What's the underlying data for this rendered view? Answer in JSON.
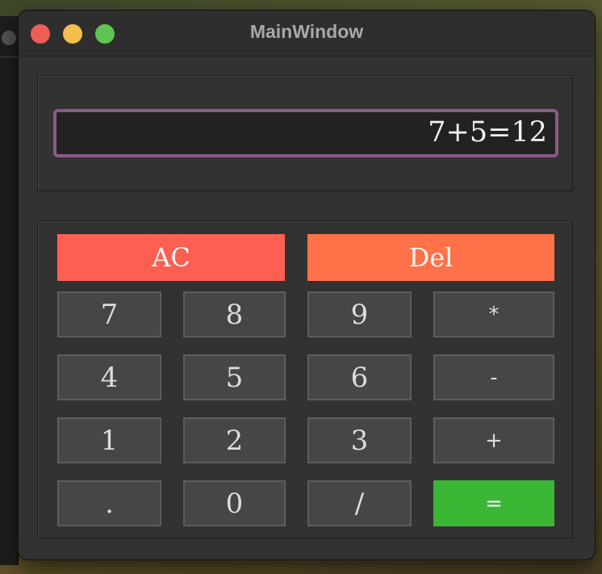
{
  "window": {
    "title": "MainWindow"
  },
  "display": {
    "value": "7+5=12"
  },
  "colors": {
    "ac_button": "#fd5f52",
    "del_button": "#ff7148",
    "equals_button": "#3ab734",
    "display_border": "#8a5a86",
    "close_light": "#ee5e55",
    "minimize_light": "#f6be4f",
    "maximize_light": "#5fc552"
  },
  "keys": {
    "ac": "AC",
    "del": "Del",
    "k7": "7",
    "k8": "8",
    "k9": "9",
    "mul": "*",
    "k4": "4",
    "k5": "5",
    "k6": "6",
    "sub": "-",
    "k1": "1",
    "k2": "2",
    "k3": "3",
    "add": "+",
    "dot": ".",
    "k0": "0",
    "div": "/",
    "eq": "="
  }
}
